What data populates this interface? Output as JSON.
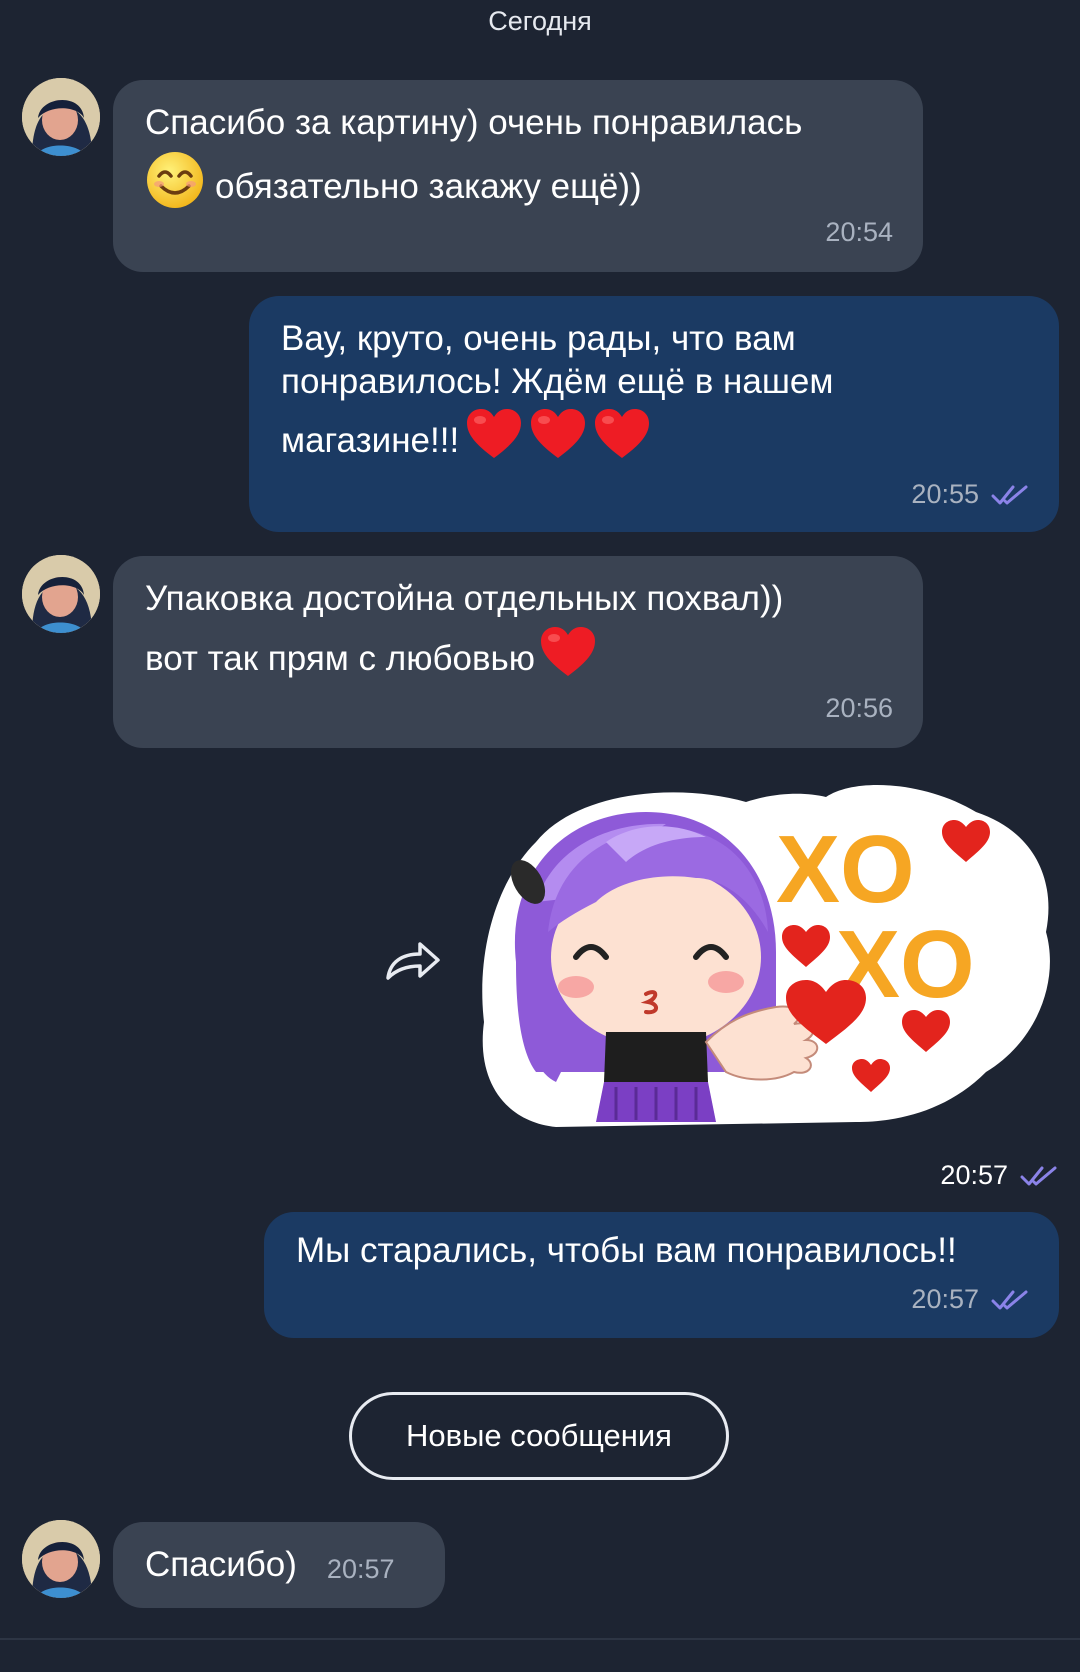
{
  "date_separator": "Сегодня",
  "messages": [
    {
      "direction": "incoming",
      "line1": "Спасибо за картину) очень понравилась",
      "line2_text": "обязательно закажу ещё))",
      "emoji": "smiling-face",
      "time": "20:54"
    },
    {
      "direction": "outgoing",
      "line1": "Вау, круто, очень рады, что вам",
      "line2": "понравилось! Ждём ещё в нашем",
      "line3_text": "магазине!!!",
      "emoji": "red-heart x3",
      "time": "20:55",
      "read": true
    },
    {
      "direction": "incoming",
      "line1": "Упаковка достойна отдельных похвал))",
      "line2_text": "вот так прям с любовью",
      "emoji": "red-heart",
      "time": "20:56"
    },
    {
      "direction": "outgoing",
      "type": "sticker",
      "sticker_text_top": "XO",
      "sticker_text_bottom": "XO",
      "time": "20:57",
      "read": true
    },
    {
      "direction": "outgoing",
      "line1": "Мы старались, чтобы вам понравилось!!",
      "time": "20:57",
      "read": true
    },
    {
      "direction": "incoming",
      "line1": "Спасибо)",
      "time": "20:57"
    }
  ],
  "new_messages_button": "Новые сообщения",
  "icons": {
    "forward": "forward-arrow-icon",
    "read_receipt": "double-check-icon",
    "avatar": "user-avatar"
  },
  "colors": {
    "background": "#1d2432",
    "incoming_bubble": "#3a4352",
    "outgoing_bubble": "#1b3a63",
    "read_check": "#8b83e8"
  }
}
